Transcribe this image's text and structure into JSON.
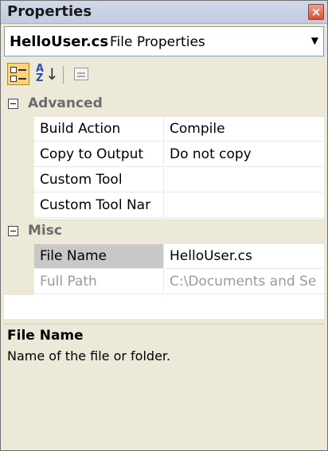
{
  "window": {
    "title": "Properties"
  },
  "selector": {
    "object_name": "HelloUser.cs",
    "object_type": "File Properties"
  },
  "toolbar": {
    "categorized_icon": "categorized-icon",
    "alphabetical_icon": "alphabetical-icon",
    "property_pages_icon": "property-pages-icon"
  },
  "categories": [
    {
      "label": "Advanced",
      "properties": [
        {
          "name": "Build Action",
          "value": "Compile"
        },
        {
          "name": "Copy to Output",
          "value": "Do not copy"
        },
        {
          "name": "Custom Tool",
          "value": ""
        },
        {
          "name": "Custom Tool Nar",
          "value": ""
        }
      ]
    },
    {
      "label": "Misc",
      "properties": [
        {
          "name": "File Name",
          "value": "HelloUser.cs",
          "selected": true
        },
        {
          "name": "Full Path",
          "value": "C:\\Documents and Se",
          "disabled": true
        }
      ]
    }
  ],
  "help": {
    "title": "File Name",
    "description": "Name of the file or folder."
  },
  "colors": {
    "background": "#ece9d8",
    "selected": "#c8c8c8",
    "category_text": "#6b6b6b"
  }
}
